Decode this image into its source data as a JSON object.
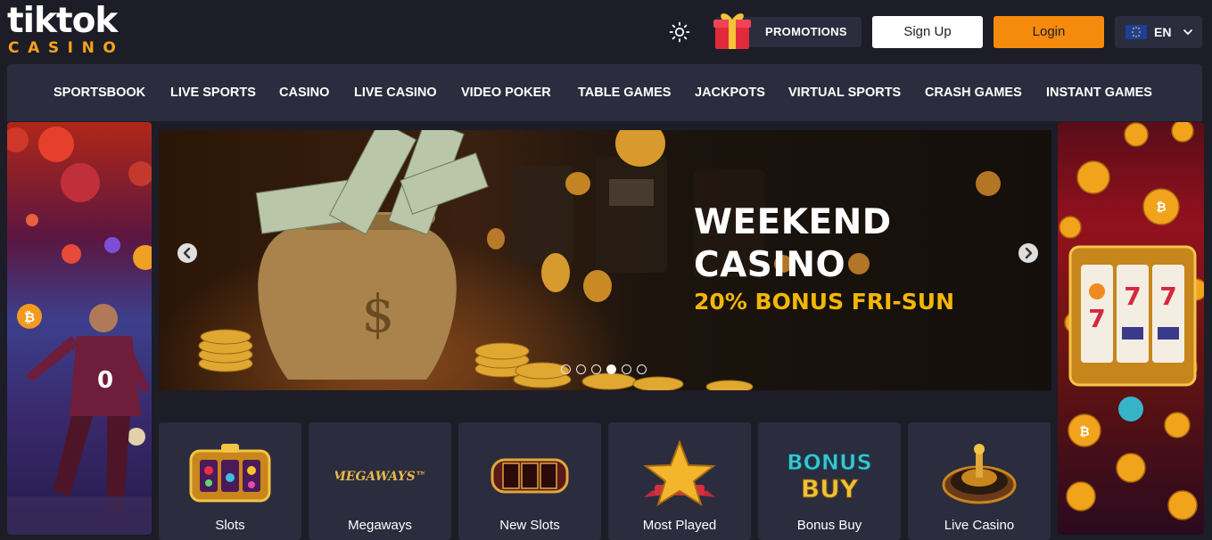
{
  "header": {
    "logo_top": "tiktok",
    "logo_bottom": "CASINO",
    "theme_icon": "sun-icon",
    "promotions_label": "PROMOTIONS",
    "signup_label": "Sign Up",
    "login_label": "Login",
    "language": "EN",
    "accent_color": "#f58a0c"
  },
  "nav": {
    "items": [
      {
        "label": "SPORTSBOOK"
      },
      {
        "label": "LIVE SPORTS"
      },
      {
        "label": "CASINO"
      },
      {
        "label": "LIVE CASINO"
      },
      {
        "label": "VIDEO POKER"
      },
      {
        "label": "TABLE GAMES"
      },
      {
        "label": "JACKPOTS"
      },
      {
        "label": "VIRTUAL SPORTS"
      },
      {
        "label": "CRASH GAMES"
      },
      {
        "label": "INSTANT GAMES"
      }
    ]
  },
  "hero": {
    "line1": "WEEKEND",
    "line2": "CASINO",
    "line3": "20% BONUS FRI-SUN",
    "slide_count": 6,
    "active_slide": 4
  },
  "categories": {
    "tiles": [
      {
        "label": "Slots",
        "icon": "slot-machine-icon"
      },
      {
        "label": "Megaways",
        "icon": "megaways-logo-icon",
        "icon_text": "MEGAWAYS™"
      },
      {
        "label": "New Slots",
        "icon": "new-slots-reel-icon"
      },
      {
        "label": "Most Played",
        "icon": "star-icon"
      },
      {
        "label": "Bonus Buy",
        "icon": "bonus-buy-icon"
      },
      {
        "label": "Live Casino",
        "icon": "roulette-wheel-icon"
      }
    ]
  }
}
